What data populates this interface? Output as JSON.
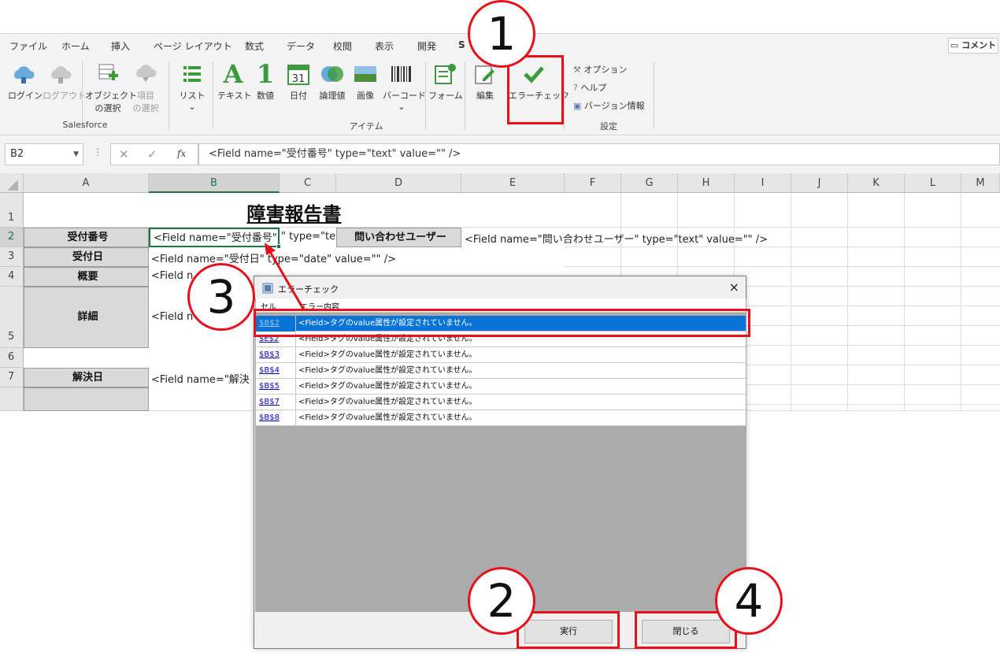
{
  "ribbon_tabs": [
    "ファイル",
    "ホーム",
    "挿入",
    "ページ レイアウト",
    "数式",
    "データ",
    "校閲",
    "表示",
    "開発",
    "S"
  ],
  "comment_button": "コメント",
  "ribbon": {
    "salesforce": {
      "login": "ログイン",
      "logout": "ログアウト",
      "object_select": [
        "オブジェクト",
        "の選択"
      ],
      "item_select": [
        "項目",
        "の選択"
      ],
      "group_label": "Salesforce"
    },
    "items": {
      "list": "リスト",
      "text": "テキスト",
      "number": "数値",
      "date": "日付",
      "logic": "論理値",
      "image": "画像",
      "barcode": "バーコード",
      "form": "フォーム",
      "group_label": "アイテム",
      "date_glyph": "31",
      "number_glyph": "1",
      "text_glyph": "A"
    },
    "edit": "編集",
    "error_check": "エラーチェック",
    "settings": {
      "options": "オプション",
      "help": "ヘルプ",
      "version": "バージョン情報",
      "group_label": "設定"
    }
  },
  "formula_bar": {
    "name_box": "B2",
    "fx": "fx",
    "formula": "<Field name=\"受付番号\" type=\"text\" value=\"\" />"
  },
  "columns": [
    "A",
    "B",
    "C",
    "D",
    "E",
    "F",
    "G",
    "H",
    "I",
    "J",
    "K",
    "L",
    "M"
  ],
  "rows": [
    "1",
    "2",
    "3",
    "4",
    "5",
    "6",
    "7"
  ],
  "sheet": {
    "title": "障害報告書",
    "a2": "受付番号",
    "b2": "<Field name=\"受付番号\" type=\"te",
    "d2": "問い合わせユーザー",
    "e2": "<Field name=\"問い合わせユーザー\" type=\"text\" value=\"\" />",
    "a3": "受付日",
    "b3": "<Field name=\"受付日\" type=\"date\" value=\"\" />",
    "a4": "概要",
    "b4": "<Field n",
    "a5": "詳細",
    "b5": "<Field n",
    "a7": "解決日",
    "b7": "<Field name=\"解決"
  },
  "dialog": {
    "title": "エラーチェック",
    "close": "×",
    "col_cell": "セル",
    "col_content": "エラー内容",
    "rows": [
      {
        "cell": "$B$2",
        "message": "<Field>タグのvalue属性が設定されていません。"
      },
      {
        "cell": "$E$2",
        "message": "<Field>タグのvalue属性が設定されていません。"
      },
      {
        "cell": "$B$3",
        "message": "<Field>タグのvalue属性が設定されていません。"
      },
      {
        "cell": "$B$4",
        "message": "<Field>タグのvalue属性が設定されていません。"
      },
      {
        "cell": "$B$5",
        "message": "<Field>タグのvalue属性が設定されていません。"
      },
      {
        "cell": "$B$7",
        "message": "<Field>タグのvalue属性が設定されていません。"
      },
      {
        "cell": "$B$8",
        "message": "<Field>タグのvalue属性が設定されていません。"
      }
    ],
    "run_button": "実行",
    "close_button": "閉じる"
  },
  "annotations": [
    "1",
    "2",
    "3",
    "4"
  ],
  "colors": {
    "annotation_red": "#e8101a",
    "selection_blue": "#0a74d6",
    "excel_green": "#217346",
    "check_green": "#3c9a3c"
  }
}
